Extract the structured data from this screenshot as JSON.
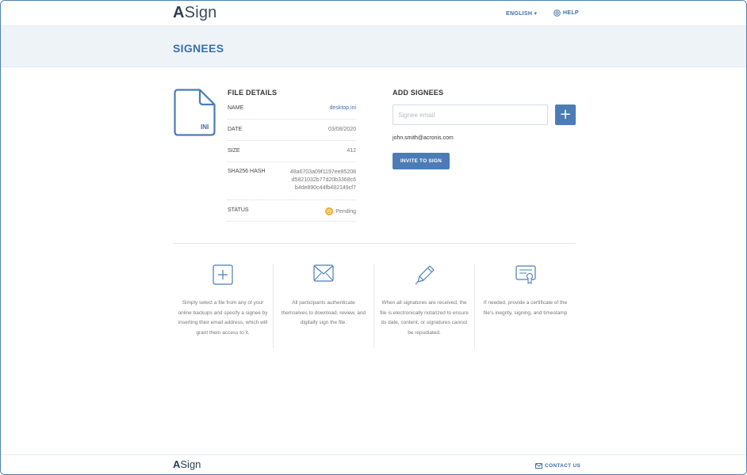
{
  "header": {
    "logo_a": "A",
    "logo_rest": "Sign",
    "language": "ENGLISH",
    "help": "HELP"
  },
  "page": {
    "title": "SIGNEES"
  },
  "file": {
    "extension": "INI",
    "section_title": "FILE DETAILS",
    "name_label": "NAME",
    "name_value": "desktop.ini",
    "date_label": "DATE",
    "date_value": "03/08/2020",
    "size_label": "SIZE",
    "size_value": "412",
    "hash_label": "SHA256 HASH",
    "hash_line1": "48a6703a09f1197ee85208",
    "hash_line2": "d5821032b77d20b3368c6",
    "hash_line3": "b4de890c44fb482149cf7",
    "status_label": "STATUS",
    "status_value": "Pending"
  },
  "signees": {
    "section_title": "ADD SIGNEES",
    "email_placeholder": "Signee email",
    "add_label": "+",
    "list": [
      "john.smith@acronis.com"
    ],
    "invite_label": "INVITE TO SIGN"
  },
  "features": [
    {
      "icon": "plus-square-icon",
      "text": "Simply select a file from any of your online backups and specify a signee by inserting their email address, which will grant them access to it."
    },
    {
      "icon": "envelope-icon",
      "text": "All participants authenticate themselves to download, review, and digitally sign the file."
    },
    {
      "icon": "pen-icon",
      "text": "When all signatures are received, the file is electronically notarized to ensure its date, content, or signatures cannot be repudiated."
    },
    {
      "icon": "certificate-icon",
      "text": "If needed, provide a certificate of the file's inegrity, signing, and timestamp"
    }
  ],
  "footer": {
    "logo_a": "A",
    "logo_rest": "Sign",
    "contact": "CONTACT US"
  },
  "colors": {
    "accent": "#3c6fa8",
    "button": "#4b7cb6",
    "band": "#eef3f8",
    "pending": "#f0a92a"
  }
}
